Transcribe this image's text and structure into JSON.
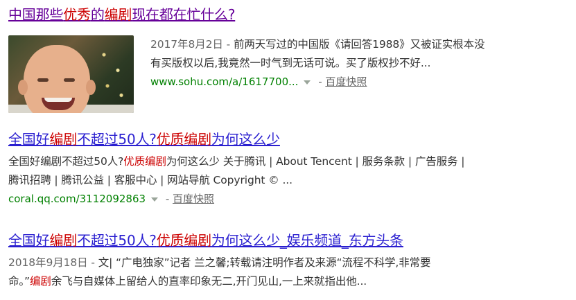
{
  "results": [
    {
      "title_parts": [
        {
          "text": "中国那些",
          "em": false
        },
        {
          "text": "优秀",
          "em": true
        },
        {
          "text": "的",
          "em": false
        },
        {
          "text": "编剧",
          "em": true
        },
        {
          "text": "现在都在忙什么?",
          "em": false
        }
      ],
      "date": "2017年8月2日",
      "date_sep": " - ",
      "abstract_line1": "前两天写过的中国版《请回答1988》又被证实根本没",
      "abstract_line2": "有买版权以后,我竟然一时气到无话可说。买了版权抄不好...",
      "url": "www.sohu.com/a/1617700...",
      "snapshot_sep": " - ",
      "snapshot": "百度快照"
    },
    {
      "title_parts": [
        {
          "text": "全国好",
          "em": false
        },
        {
          "text": "编剧",
          "em": true
        },
        {
          "text": "不超过50人?",
          "em": false
        },
        {
          "text": "优质编剧",
          "em": true
        },
        {
          "text": "为何这么少",
          "em": false
        }
      ],
      "abstract_line1_parts": [
        {
          "text": "全国好编剧不超过50人?",
          "em": false
        },
        {
          "text": "优质编剧",
          "em": true
        },
        {
          "text": "为何这么少 关于腾讯 | About Tencent | 服务条款 | 广告服务 |",
          "em": false
        }
      ],
      "abstract_line2": "腾讯招聘 | 腾讯公益 | 客服中心 | 网站导航 Copyright © ...",
      "url": "coral.qq.com/3112092863",
      "snapshot_sep": " - ",
      "snapshot": "百度快照"
    },
    {
      "title_parts": [
        {
          "text": "全国好",
          "em": false
        },
        {
          "text": "编剧",
          "em": true
        },
        {
          "text": "不超过50人?",
          "em": false
        },
        {
          "text": "优质编剧",
          "em": true
        },
        {
          "text": "为何这么少_娱乐频道_东方头条",
          "em": false
        }
      ],
      "date": "2018年9月18日",
      "date_sep": " - ",
      "abstract_line1": "文| “广电独家”记者 兰之馨;转载请注明作者及来源“流程不科学,非常要",
      "abstract_line2_parts": [
        {
          "text": "命。”",
          "em": false
        },
        {
          "text": "编剧",
          "em": true
        },
        {
          "text": "余飞与自媒体上留给人的直率印象无二,开门见山,一上来就指出他...",
          "em": false
        }
      ]
    }
  ],
  "colors": {
    "visited": "#660099",
    "link": "#2a1fd0",
    "highlight": "#cc0000",
    "url": "#008000",
    "meta": "#666666"
  },
  "icons": [
    "dropdown-arrow-icon"
  ]
}
